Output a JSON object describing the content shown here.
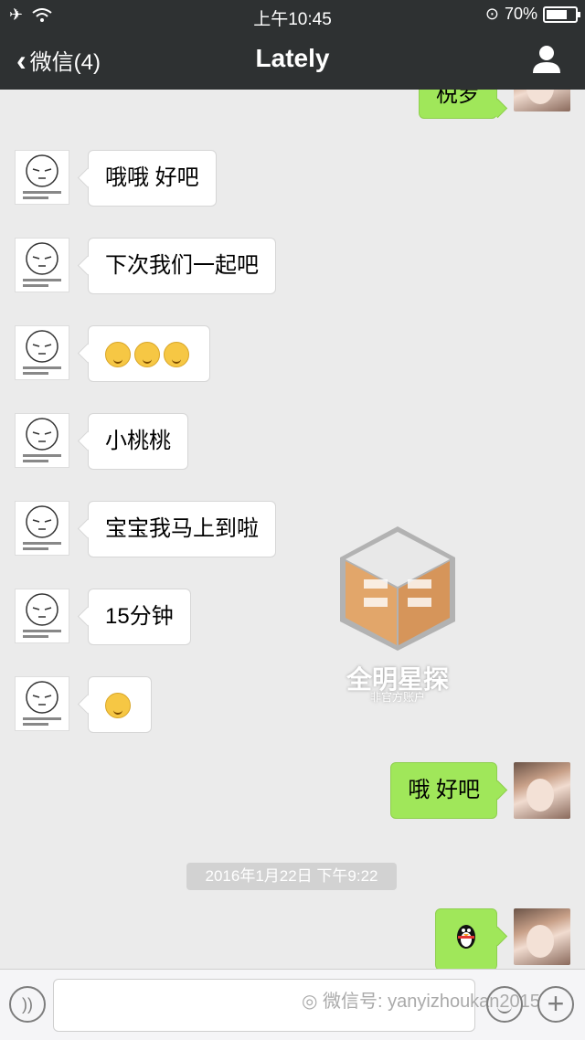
{
  "status_bar": {
    "time": "上午10:45",
    "battery": "70%"
  },
  "nav": {
    "back_label": "微信(4)",
    "title": "Lately"
  },
  "messages": {
    "partial_top": "棁罗",
    "m1": "哦哦 好吧",
    "m2": "下次我们一起吧",
    "m4": "小桃桃",
    "m5": "宝宝我马上到啦",
    "m6": "15分钟",
    "m8": "哦 好吧"
  },
  "timestamp": "2016年1月22日 下午9:22",
  "watermark": {
    "title": "全明星探",
    "subtitle": "非官方账户",
    "footer": "微信号: yanyizhoukan2015"
  },
  "colors": {
    "nav_bg": "#2e3132",
    "chat_bg": "#ebebeb",
    "bubble_right": "#a0e75a"
  }
}
